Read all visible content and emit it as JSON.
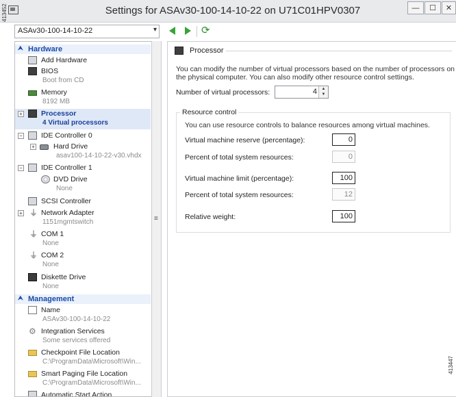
{
  "window": {
    "title": "Settings for ASAv30-100-14-10-22 on U71C01HPV0307",
    "side_id": "413452",
    "ref_id": "413447",
    "buttons": {
      "minimize": "—",
      "maximize": "☐",
      "close": "✕"
    }
  },
  "toolbar": {
    "vm_selected": "ASAv30-100-14-10-22"
  },
  "tree": {
    "hardware_label": "Hardware",
    "management_label": "Management",
    "hardware_items": [
      {
        "label": "Add Hardware",
        "sub": "",
        "icon": "add-hardware-icon"
      },
      {
        "label": "BIOS",
        "sub": "Boot from CD",
        "icon": "bios-icon"
      },
      {
        "label": "Memory",
        "sub": "8192 MB",
        "icon": "memory-icon"
      },
      {
        "label": "Processor",
        "sub": "4 Virtual processors",
        "icon": "processor-icon",
        "selected": true
      },
      {
        "label": "IDE Controller 0",
        "sub": "",
        "icon": "ide-controller-icon"
      },
      {
        "label": "Hard Drive",
        "sub": "asav100-14-10-22-v30.vhdx",
        "icon": "hard-drive-icon"
      },
      {
        "label": "IDE Controller 1",
        "sub": "",
        "icon": "ide-controller-icon"
      },
      {
        "label": "DVD Drive",
        "sub": "None",
        "icon": "dvd-drive-icon"
      },
      {
        "label": "SCSI Controller",
        "sub": "",
        "icon": "scsi-controller-icon"
      },
      {
        "label": "Network Adapter",
        "sub": "1151mgmtswitch",
        "icon": "network-adapter-icon"
      },
      {
        "label": "COM 1",
        "sub": "None",
        "icon": "com-port-icon"
      },
      {
        "label": "COM 2",
        "sub": "None",
        "icon": "com-port-icon"
      },
      {
        "label": "Diskette Drive",
        "sub": "None",
        "icon": "diskette-icon"
      }
    ],
    "management_items": [
      {
        "label": "Name",
        "sub": "ASAv30-100-14-10-22",
        "icon": "name-icon"
      },
      {
        "label": "Integration Services",
        "sub": "Some services offered",
        "icon": "integration-services-icon"
      },
      {
        "label": "Checkpoint File Location",
        "sub": "C:\\ProgramData\\Microsoft\\Win...",
        "icon": "folder-icon"
      },
      {
        "label": "Smart Paging File Location",
        "sub": "C:\\ProgramData\\Microsoft\\Win...",
        "icon": "folder-icon"
      },
      {
        "label": "Automatic Start Action",
        "sub": "",
        "icon": "start-action-icon"
      }
    ]
  },
  "processor": {
    "heading": "Processor",
    "desc_line1": "You can modify the number of virtual processors based on the number of processors on",
    "desc_line2": "the physical computer. You can also modify other resource control settings.",
    "nvp_label": "Number of virtual processors:",
    "nvp_value": "4",
    "resource_control": {
      "title": "Resource control",
      "desc": "You can use resource controls to balance resources among virtual machines.",
      "fields": [
        {
          "label": "Virtual machine reserve (percentage):",
          "value": "0",
          "readonly": false
        },
        {
          "label": "Percent of total system resources:",
          "value": "0",
          "readonly": true
        },
        {
          "label": "Virtual machine limit (percentage):",
          "value": "100",
          "readonly": false
        },
        {
          "label": "Percent of total system resources:",
          "value": "12",
          "readonly": true
        },
        {
          "label": "Relative weight:",
          "value": "100",
          "readonly": false
        }
      ]
    }
  }
}
